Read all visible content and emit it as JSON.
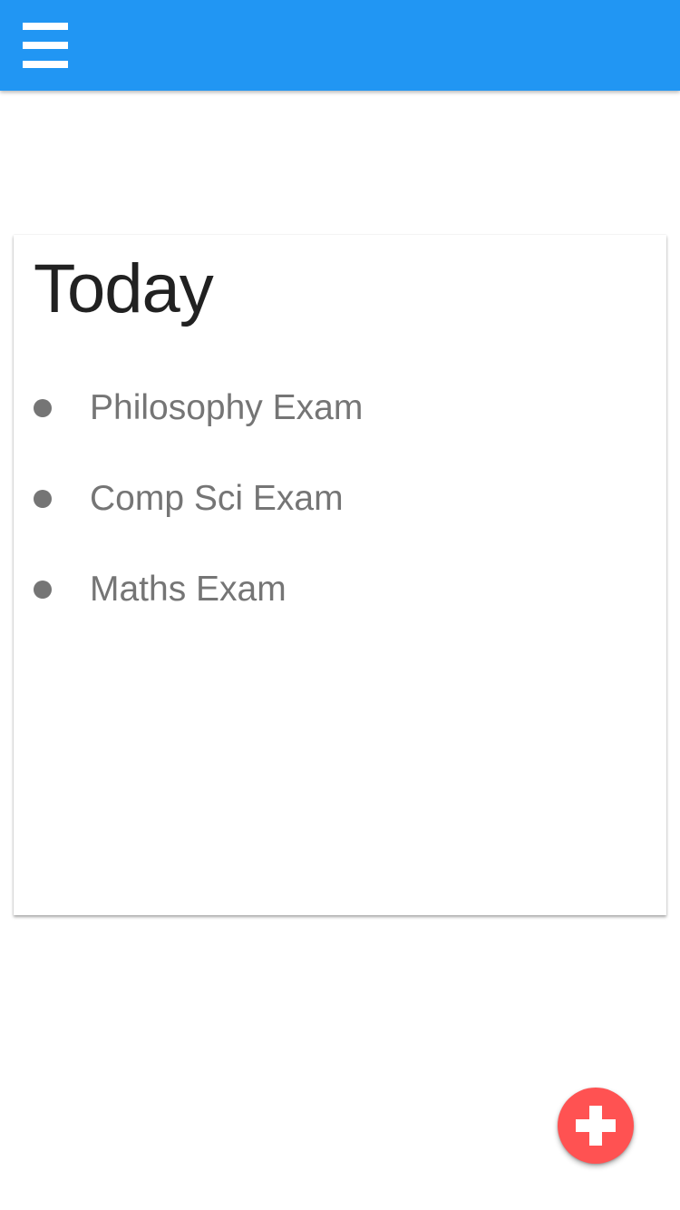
{
  "app_bar": {
    "color": "#2196F3",
    "menu_icon": "hamburger-menu-icon"
  },
  "card": {
    "title": "Today",
    "items": [
      {
        "label": "Philosophy Exam"
      },
      {
        "label": "Comp Sci Exam"
      },
      {
        "label": "Maths Exam"
      }
    ]
  },
  "fab": {
    "color": "#FF5252",
    "icon": "plus-icon"
  }
}
